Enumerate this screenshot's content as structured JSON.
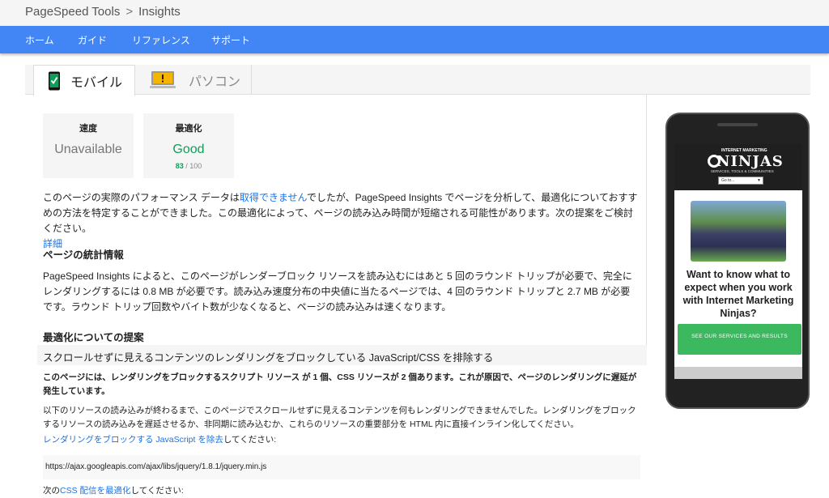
{
  "breadcrumb": {
    "root": "PageSpeed Tools",
    "separator": ">",
    "current": "Insights"
  },
  "nav": {
    "items": [
      "ホーム",
      "ガイド",
      "リファレンス",
      "サポート"
    ]
  },
  "tabs": {
    "mobile": "モバイル",
    "desktop": "パソコン"
  },
  "scores": {
    "speed": {
      "title": "速度",
      "value": "Unavailable"
    },
    "optimization": {
      "title": "最適化",
      "value": "Good",
      "score": "83",
      "max": " / 100"
    }
  },
  "intro": {
    "before_link": "このページの実際のパフォーマンス データは",
    "link": "取得できません",
    "after_link": "でしたが、PageSpeed Insights でページを分析して、最適化についておすすめの方法を特定することができました。この最適化によって、ページの読み込み時間が短縮される可能性があります。次の提案をご検討ください。",
    "details_link": "詳細"
  },
  "stats": {
    "heading": "ページの統計情報",
    "text": "PageSpeed Insights によると、このページがレンダーブロック リソースを読み込むにはあと 5 回のラウンド トリップが必要で、完全にレンダリングするには 0.8 MB が必要です。読み込み速度分布の中央値に当たるページでは、4 回のラウンド トリップと 2.7 MB が必要です。ラウンド トリップ回数やバイト数が少なくなると、ページの読み込みは速くなります。"
  },
  "suggestions": {
    "heading": "最適化についての提案",
    "rule_title": "スクロールせずに見えるコンテンツのレンダリングをブロックしている JavaScript/CSS を排除する",
    "summary": "このページには、レンダリングをブロックするスクリプト リソース が 1 個、CSS リソースが 2 個あります。これが原因で、ページのレンダリングに遅延が発生しています。",
    "explanation": "以下のリソースの読み込みが終わるまで、このページでスクロールせずに見えるコンテンツを何もレンダリングできませんでした。レンダリングをブロックするリソースの読み込みを遅延させるか、非同期に読み込むか、これらのリソースの重要部分を HTML 内に直接インライン化してください。",
    "js_link": "レンダリングをブロックする JavaScript を除去",
    "js_after": "してください:",
    "js_url": "https://ajax.googleapis.com/ajax/libs/jquery/1.8.1/jquery.min.js",
    "css_before": "次の",
    "css_link": "CSS 配信を最適化",
    "css_after": "してください:"
  },
  "preview": {
    "brand_top": "INTERNET MARKETING",
    "brand": "NINJAS",
    "brand_sub": "SERVICES, TOOLS & COMMUNITIES",
    "goto": "Go to...",
    "headline": "Want to know what to expect when you work with Internet Marketing Ninjas?",
    "button": "SEE OUR SERVICES AND RESULTS"
  },
  "colors": {
    "nav_bg": "#4285f4",
    "good": "#0f9d58",
    "link": "#1a73e8",
    "cta": "#3cb95f"
  }
}
